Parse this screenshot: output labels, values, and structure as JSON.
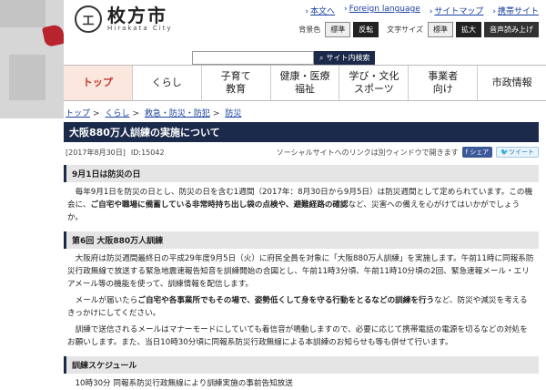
{
  "header": {
    "logo_mark": "工",
    "logo_ja": "枚方市",
    "logo_en": "Hirakata City",
    "toplinks": [
      "本文へ",
      "Foreign language",
      "サイトマップ",
      "携帯サイト"
    ],
    "access": {
      "bg_label": "背景色",
      "bg_standard": "標準",
      "bg_invert": "反転",
      "font_label": "文字サイズ",
      "font_standard": "標準",
      "font_enlarge": "拡大",
      "read_aloud": "音声読み上げ"
    },
    "search_button": "サイト内検索",
    "search_placeholder": ""
  },
  "nav": [
    {
      "label": "トップ",
      "active": true
    },
    {
      "label": "くらし"
    },
    {
      "label": "子育て\n教育"
    },
    {
      "label": "健康・医療\n福祉"
    },
    {
      "label": "学び・文化\nスポーツ"
    },
    {
      "label": "事業者\n向け"
    },
    {
      "label": "市政情報"
    }
  ],
  "breadcrumb": [
    "トップ",
    "くらし",
    "救急・防災・防犯",
    "防災"
  ],
  "page": {
    "title": "大阪880万人訓練の実施について",
    "date": "[2017年8月30日]",
    "id": "ID:15042",
    "social_note": "ソーシャルサイトへのリンクは別ウィンドウで開きます",
    "share_label": "シェア",
    "tweet_label": "ツイート"
  },
  "sections": {
    "s1_title": "9月1日は防災の日",
    "s1_p1": "毎年9月1日を防災の日とし、防災の日を含む1週間（2017年：8月30日から9月5日）は防災週間として定められています。この機会に、",
    "s1_em": "ご自宅や職場に備蓄している非常時持ち出し袋の点検や、避難経路の確認",
    "s1_p2": "など、災害への備えを心がけてはいかがでしょうか。",
    "s2_title": "第6回 大阪880万人訓練",
    "s2_p1": "大阪府は防災週間最終日の平成29年度9月5日（火）に府民全員を対象に「大阪880万人訓練」を実施します。午前11時に同報系防災行政無線で放送する緊急地震速報告知音を訓練開始の合図とし、午前11時3分頃、午前11時10分頃の2回、緊急速報メール・エリアメール等の機能を使って、訓練情報を配信します。",
    "s2_p2a": "メールが届いたら",
    "s2_em": "ご自宅や各事業所でもその場で、姿勢低くして身を守る行動をとるなどの訓練を行う",
    "s2_p2b": "など、防災や減災を考えるきっかけにしてください。",
    "s2_p3": "訓練で送信されるメールはマナーモードにしていても着信音が鳴動しますので、必要に応じて携帯電話の電源を切るなどの対処をお願いします。また、当日10時30分頃に同報系防災行政無線による本訓練のお知らせも等も併せて行います。",
    "s3_title": "訓練スケジュール",
    "s3_p1": "10時30分 同報系防災行政無線により訓練実施の事前告知放送"
  }
}
